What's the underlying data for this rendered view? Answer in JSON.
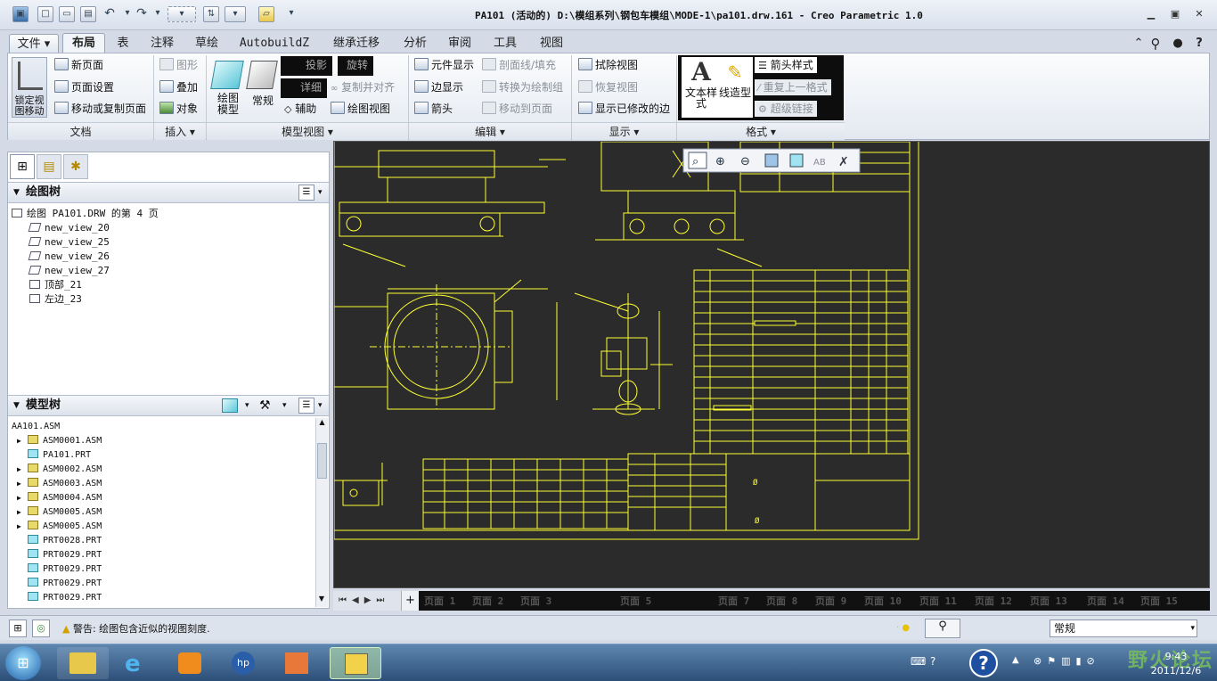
{
  "window": {
    "title": "PA101 (活动的) D:\\模组系列\\钢包车模组\\MODE-1\\pa101.drw.161 - Creo Parametric 1.0"
  },
  "menu": {
    "file": "文件",
    "tabs": [
      "布局",
      "表",
      "注释",
      "草绘",
      "AutobuildZ",
      "继承迁移",
      "分析",
      "审阅",
      "工具",
      "视图"
    ]
  },
  "ribbon": {
    "doc": {
      "lock": "锁定视图移动",
      "new_page": "新页面",
      "page_setup": "页面设置",
      "move_copy": "移动或复制页面",
      "label": "文档"
    },
    "insert": {
      "graphic": "图形",
      "overlay": "叠加",
      "object": "对象",
      "label": "插入"
    },
    "model_views": {
      "drawing_model": "绘图模型",
      "general": "常规",
      "projection": "投影",
      "rotate": "旋转",
      "detail": "详细",
      "copy_align": "复制并对齐",
      "auxiliary": "辅助",
      "drawing_view": "绘图视图",
      "label": "模型视图"
    },
    "edit": {
      "element_display": "元件显示",
      "section_fill": "剖面线/填充",
      "edge_display": "边显示",
      "convert_group": "转换为绘制组",
      "arrow": "箭头",
      "move_to_page": "移动到页面",
      "label": "编辑"
    },
    "display": {
      "erase_view": "拭除视图",
      "resume_view": "恢复视图",
      "show_modified": "显示已修改的边",
      "label": "显示"
    },
    "format": {
      "text_style": "文本样式",
      "line_style": "线造型",
      "arrow_style": "箭头样式",
      "repeat_format": "重复上一格式",
      "hyperlink": "超级链接",
      "label": "格式"
    }
  },
  "drawing_tree": {
    "header": "绘图树",
    "root": "绘图 PA101.DRW 的第 4 页",
    "items": [
      "new_view_20",
      "new_view_25",
      "new_view_26",
      "new_view_27",
      "顶部_21",
      "左边_23"
    ]
  },
  "model_tree": {
    "header": "模型树",
    "root": "AA101.ASM",
    "items": [
      {
        "name": "ASM0001.ASM",
        "type": "asm",
        "expand": true
      },
      {
        "name": "PA101.PRT",
        "type": "prt",
        "expand": false
      },
      {
        "name": "ASM0002.ASM",
        "type": "asm",
        "expand": true
      },
      {
        "name": "ASM0003.ASM",
        "type": "asm",
        "expand": true
      },
      {
        "name": "ASM0004.ASM",
        "type": "asm",
        "expand": true
      },
      {
        "name": "ASM0005.ASM",
        "type": "asm",
        "expand": true
      },
      {
        "name": "ASM0005.ASM",
        "type": "asm",
        "expand": true
      },
      {
        "name": "PRT0028.PRT",
        "type": "prt",
        "expand": false
      },
      {
        "name": "PRT0029.PRT",
        "type": "prt",
        "expand": false
      },
      {
        "name": "PRT0029.PRT",
        "type": "prt",
        "expand": false
      },
      {
        "name": "PRT0029.PRT",
        "type": "prt",
        "expand": false
      },
      {
        "name": "PRT0029.PRT",
        "type": "prt",
        "expand": false
      }
    ]
  },
  "pages": [
    "页面 1",
    "页面 2",
    "页面 3",
    "页面 5",
    "页面 7",
    "页面 8",
    "页面 9",
    "页面 10",
    "页面 11",
    "页面 12",
    "页面 13",
    "页面 14",
    "页面 15"
  ],
  "status": {
    "message": "警告: 绘图包含近似的视图刻度.",
    "filter": "常规"
  },
  "clock": {
    "time": "9:43",
    "date": "2011/12/6"
  },
  "watermark": "野火论坛",
  "colors": {
    "canvas_bg": "#2b2b2b",
    "drawing_line": "#ffff33",
    "ribbon_bg": "#f1f4f9"
  }
}
